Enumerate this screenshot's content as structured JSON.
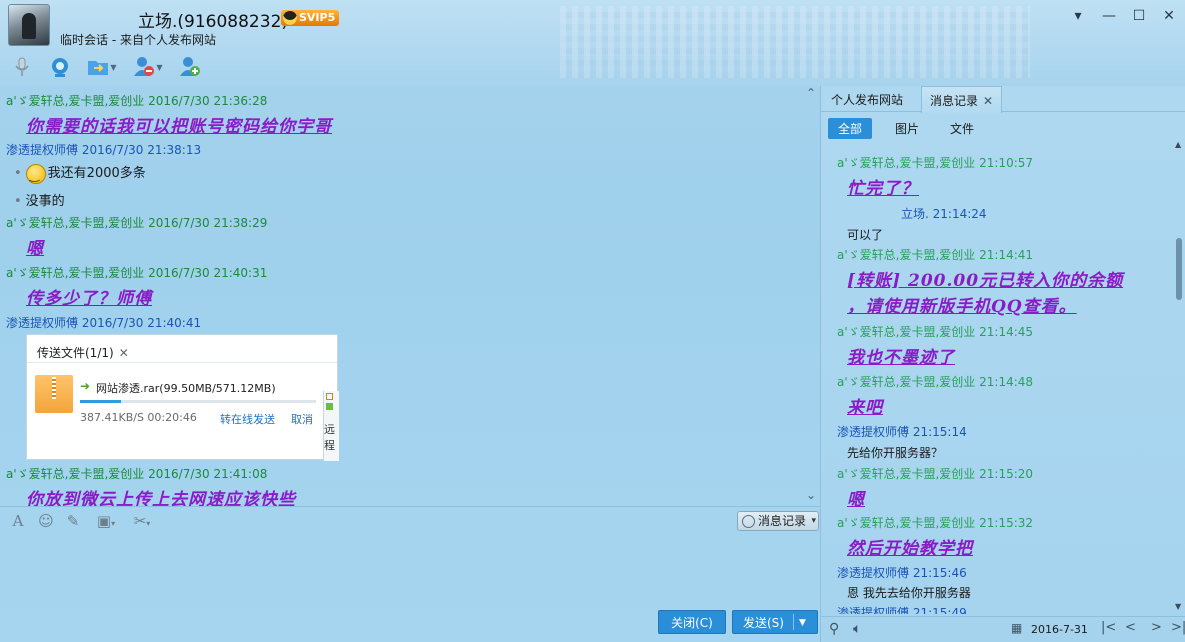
{
  "window": {
    "contact_name": "立场.(916088232)",
    "vip_badge": "SVIP5",
    "session_info": "临时会话 - 来自个人发布网站",
    "controls": {
      "menu": "▾",
      "minimize": "—",
      "maximize": "☐",
      "close": "✕"
    }
  },
  "toolbar_icons": [
    "microphone-icon",
    "video-icon",
    "file-transfer-icon",
    "remote-assist-icon",
    "add-contact-icon"
  ],
  "chat": {
    "messages": [
      {
        "sender": "a'ゞ爱轩总,爱卡盟,爱创业",
        "time": "2016/7/30 21:36:28",
        "text": "你需要的话我可以把账号密码给你宇哥"
      },
      {
        "sender": "渗透提权师傅",
        "time": "2016/7/30 21:38:13",
        "lines": [
          "我还有2000多条",
          "没事的"
        ]
      },
      {
        "sender": "a'ゞ爱轩总,爱卡盟,爱创业",
        "time": "2016/7/30 21:38:29",
        "text": "嗯"
      },
      {
        "sender": "a'ゞ爱轩总,爱卡盟,爱创业",
        "time": "2016/7/30 21:40:31",
        "text": "传多少了？师傅"
      },
      {
        "sender": "渗透提权师傅",
        "time": "2016/7/30 21:40:41"
      },
      {
        "sender": "a'ゞ爱轩总,爱卡盟,爱创业",
        "time": "2016/7/30 21:41:08",
        "text": "你放到微云上传上去网速应该快些"
      }
    ],
    "file_transfer": {
      "title": "传送文件(1/1)",
      "close": "✕",
      "file_name": "网站渗透.rar(99.50MB/571.12MB)",
      "progress": 0.174,
      "rate_time": "387.41KB/S 00:20:46",
      "online_send": "转在线发送",
      "cancel": "取消",
      "side_text": "远程"
    }
  },
  "input": {
    "history_button": "消息记录",
    "close_button": "关闭(C)",
    "send_button": "发送(S)"
  },
  "panel": {
    "tabs": [
      "个人发布网站",
      "消息记录"
    ],
    "filters": [
      "全部",
      "图片",
      "文件"
    ],
    "history": [
      {
        "sender": "a'ゞ爱轩总,爱卡盟,爱创业",
        "time": "21:10:57",
        "text": "忙完了？"
      },
      {
        "sender": "立场.",
        "time": "21:14:24",
        "text": "可以了"
      },
      {
        "sender": "a'ゞ爱轩总,爱卡盟,爱创业",
        "time": "21:14:41",
        "text_lines": [
          "[转账] 200.00元已转入你的余额",
          "，请使用新版手机QQ查看。"
        ]
      },
      {
        "sender": "a'ゞ爱轩总,爱卡盟,爱创业",
        "time": "21:14:45",
        "text": "我也不墨迹了"
      },
      {
        "sender": "a'ゞ爱轩总,爱卡盟,爱创业",
        "time": "21:14:48",
        "text": "来吧"
      },
      {
        "sender": "渗透提权师傅",
        "time": "21:15:14",
        "text": "先给你开服务器？"
      },
      {
        "sender": "a'ゞ爱轩总,爱卡盟,爱创业",
        "time": "21:15:20",
        "text": "嗯"
      },
      {
        "sender": "a'ゞ爱轩总,爱卡盟,爱创业",
        "time": "21:15:32",
        "text": "然后开始教学把"
      },
      {
        "sender": "渗透提权师傅",
        "time": "21:15:46",
        "text": "恩  我先去给你开服务器"
      },
      {
        "sender": "渗透提权师傅",
        "time": "21:15:49"
      }
    ],
    "footer": {
      "date": "2016-7-31"
    }
  },
  "colors": {
    "accent": "#2a8fd8",
    "art_text": "#8a1bc8",
    "sender_green": "#1b8a3e",
    "sender_blue": "#1b54b8"
  }
}
